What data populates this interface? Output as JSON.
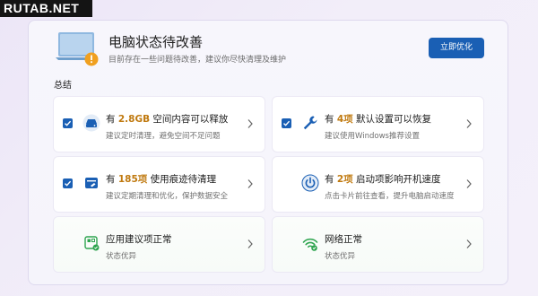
{
  "watermark": "RUTAB.NET",
  "header": {
    "title": "电脑状态待改善",
    "subtitle": "目前存在一些问题待改善，建议你尽快清理及维护",
    "button_label": "立即优化"
  },
  "section_label": "总结",
  "cards": [
    {
      "prefix": "有 ",
      "highlight": "2.8GB",
      "suffix": " 空间内容可以释放",
      "subtitle": "建议定时清理，避免空间不足问题",
      "checked": true,
      "icon": "disk-icon"
    },
    {
      "prefix": "有 ",
      "highlight": "4项",
      "suffix": " 默认设置可以恢复",
      "subtitle": "建议使用Windows推荐设置",
      "checked": true,
      "icon": "wrench-icon"
    },
    {
      "prefix": "有 ",
      "highlight": "185项",
      "suffix": " 使用痕迹待清理",
      "subtitle": "建议定期清理和优化，保护数据安全",
      "checked": true,
      "icon": "trace-icon"
    },
    {
      "prefix": "有 ",
      "highlight": "2项",
      "suffix": " 启动项影响开机速度",
      "subtitle": "点击卡片前往查看，提升电脑启动速度",
      "checked": false,
      "icon": "power-icon"
    },
    {
      "title": "应用建议项正常",
      "subtitle": "状态优异",
      "checked": false,
      "icon": "app-suggest-icon"
    },
    {
      "title": "网络正常",
      "subtitle": "状态优异",
      "checked": false,
      "icon": "network-icon"
    }
  ],
  "colors": {
    "accent": "#1a5fb4",
    "highlight": "#c07a10",
    "warning": "#f0a020",
    "ok_green": "#2ea44f"
  }
}
